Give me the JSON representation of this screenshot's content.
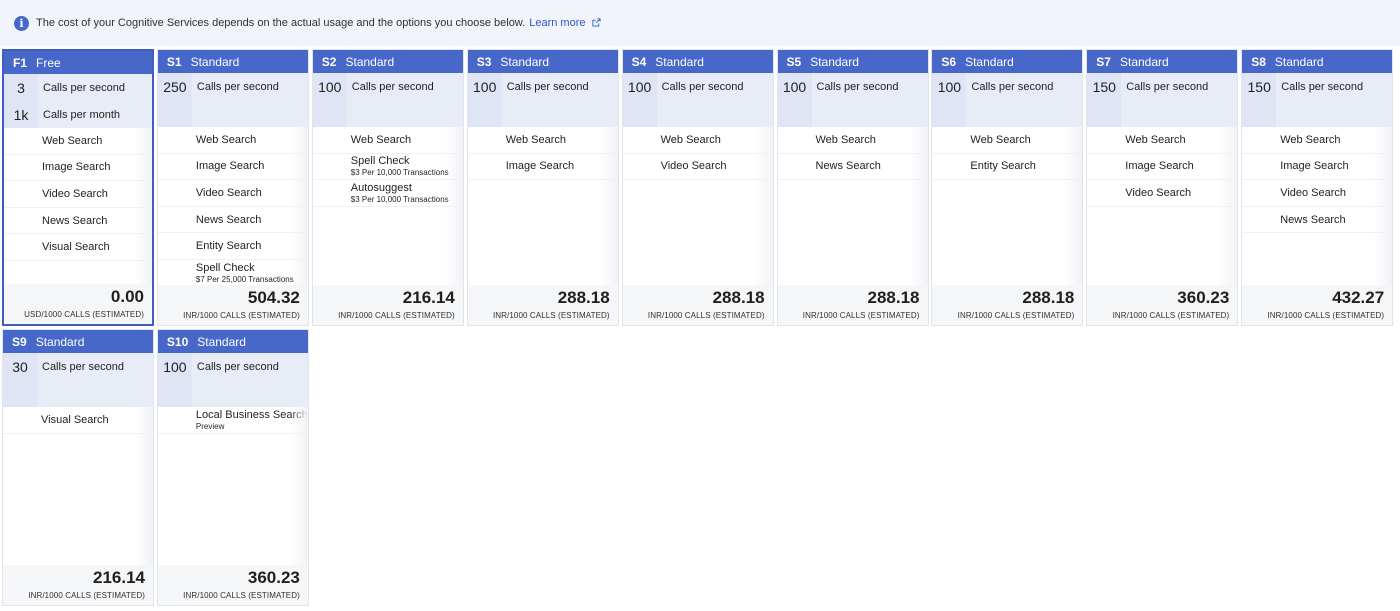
{
  "banner": {
    "icon": "info-icon",
    "text": "The cost of your Cognitive Services depends on the actual usage and the options you choose below.",
    "link": "Learn more",
    "link_icon": "external-link-icon"
  },
  "colors": {
    "header": "#4767c9",
    "selected_border": "#3f5ec0",
    "link": "#2b58c7"
  },
  "tiers": [
    {
      "code": "F1",
      "name": "Free",
      "selected": true,
      "quotas": [
        {
          "value": "3",
          "label": "Calls per second"
        },
        {
          "value": "1k",
          "label": "Calls per month"
        }
      ],
      "features": [
        {
          "name": "Web Search",
          "note": ""
        },
        {
          "name": "Image Search",
          "note": ""
        },
        {
          "name": "Video Search",
          "note": ""
        },
        {
          "name": "News Search",
          "note": ""
        },
        {
          "name": "Visual Search",
          "note": ""
        }
      ],
      "price": "0.00",
      "unit": "USD/1000 CALLS (ESTIMATED)"
    },
    {
      "code": "S1",
      "name": "Standard",
      "selected": false,
      "quotas": [
        {
          "value": "250",
          "label": "Calls per second"
        }
      ],
      "features": [
        {
          "name": "Web Search",
          "note": ""
        },
        {
          "name": "Image Search",
          "note": ""
        },
        {
          "name": "Video Search",
          "note": ""
        },
        {
          "name": "News Search",
          "note": ""
        },
        {
          "name": "Entity Search",
          "note": ""
        },
        {
          "name": "Spell Check",
          "note": "$7 Per 25,000 Transactions"
        }
      ],
      "price": "504.32",
      "unit": "INR/1000 CALLS (ESTIMATED)"
    },
    {
      "code": "S2",
      "name": "Standard",
      "selected": false,
      "quotas": [
        {
          "value": "100",
          "label": "Calls per second"
        }
      ],
      "features": [
        {
          "name": "Web Search",
          "note": ""
        },
        {
          "name": "Spell Check",
          "note": "$3 Per 10,000 Transactions"
        },
        {
          "name": "Autosuggest",
          "note": "$3 Per 10,000 Transactions"
        }
      ],
      "price": "216.14",
      "unit": "INR/1000 CALLS (ESTIMATED)"
    },
    {
      "code": "S3",
      "name": "Standard",
      "selected": false,
      "quotas": [
        {
          "value": "100",
          "label": "Calls per second"
        }
      ],
      "features": [
        {
          "name": "Web Search",
          "note": ""
        },
        {
          "name": "Image Search",
          "note": ""
        }
      ],
      "price": "288.18",
      "unit": "INR/1000 CALLS (ESTIMATED)"
    },
    {
      "code": "S4",
      "name": "Standard",
      "selected": false,
      "quotas": [
        {
          "value": "100",
          "label": "Calls per second"
        }
      ],
      "features": [
        {
          "name": "Web Search",
          "note": ""
        },
        {
          "name": "Video Search",
          "note": ""
        }
      ],
      "price": "288.18",
      "unit": "INR/1000 CALLS (ESTIMATED)"
    },
    {
      "code": "S5",
      "name": "Standard",
      "selected": false,
      "quotas": [
        {
          "value": "100",
          "label": "Calls per second"
        }
      ],
      "features": [
        {
          "name": "Web Search",
          "note": ""
        },
        {
          "name": "News Search",
          "note": ""
        }
      ],
      "price": "288.18",
      "unit": "INR/1000 CALLS (ESTIMATED)"
    },
    {
      "code": "S6",
      "name": "Standard",
      "selected": false,
      "quotas": [
        {
          "value": "100",
          "label": "Calls per second"
        }
      ],
      "features": [
        {
          "name": "Web Search",
          "note": ""
        },
        {
          "name": "Entity Search",
          "note": ""
        }
      ],
      "price": "288.18",
      "unit": "INR/1000 CALLS (ESTIMATED)"
    },
    {
      "code": "S7",
      "name": "Standard",
      "selected": false,
      "quotas": [
        {
          "value": "150",
          "label": "Calls per second"
        }
      ],
      "features": [
        {
          "name": "Web Search",
          "note": ""
        },
        {
          "name": "Image Search",
          "note": ""
        },
        {
          "name": "Video Search",
          "note": ""
        }
      ],
      "price": "360.23",
      "unit": "INR/1000 CALLS (ESTIMATED)"
    },
    {
      "code": "S8",
      "name": "Standard",
      "selected": false,
      "quotas": [
        {
          "value": "150",
          "label": "Calls per second"
        }
      ],
      "features": [
        {
          "name": "Web Search",
          "note": ""
        },
        {
          "name": "Image Search",
          "note": ""
        },
        {
          "name": "Video Search",
          "note": ""
        },
        {
          "name": "News Search",
          "note": ""
        }
      ],
      "price": "432.27",
      "unit": "INR/1000 CALLS (ESTIMATED)"
    },
    {
      "code": "S9",
      "name": "Standard",
      "selected": false,
      "quotas": [
        {
          "value": "30",
          "label": "Calls per second"
        }
      ],
      "features": [
        {
          "name": "Visual Search",
          "note": ""
        }
      ],
      "price": "216.14",
      "unit": "INR/1000 CALLS (ESTIMATED)"
    },
    {
      "code": "S10",
      "name": "Standard",
      "selected": false,
      "quotas": [
        {
          "value": "100",
          "label": "Calls per second"
        }
      ],
      "features": [
        {
          "name": "Local Business Search",
          "note": "Preview"
        }
      ],
      "price": "360.23",
      "unit": "INR/1000 CALLS (ESTIMATED)"
    }
  ]
}
